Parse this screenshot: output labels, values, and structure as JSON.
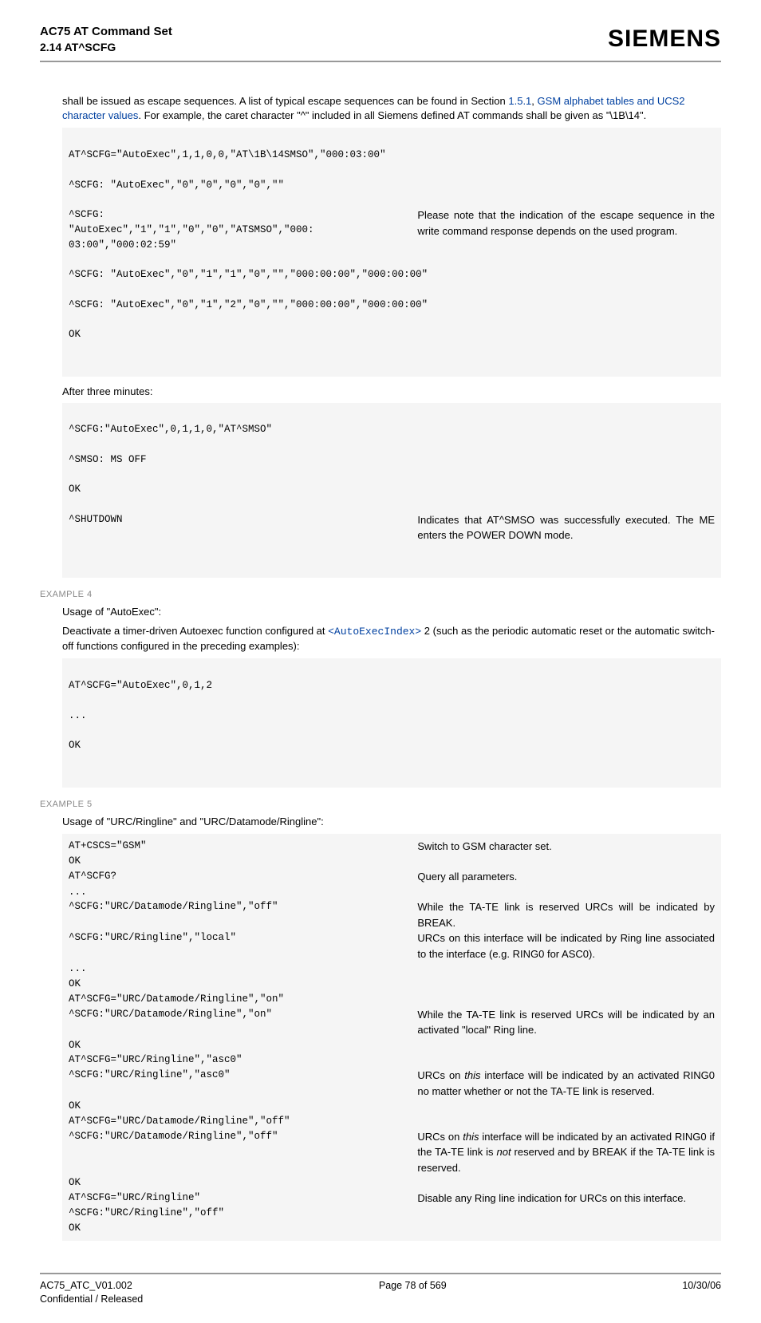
{
  "header": {
    "title_line1": "AC75 AT Command Set",
    "title_line2": "2.14 AT^SCFG",
    "brand": "SIEMENS"
  },
  "intro": {
    "text_before_link": "shall be issued as escape sequences. A list of typical escape sequences can be found in Section ",
    "link1": "1.5.1",
    "sep": ", ",
    "link2": "GSM alphabet tables and UCS2 character values",
    "text_after_link": ". For example, the caret character \"^\" included in all Siemens defined AT commands shall be given as \"\\1B\\14\"."
  },
  "block1": {
    "l1": "AT^SCFG=\"AutoExec\",1,1,0,0,\"AT\\1B\\14SMSO\",\"000:03:00\"",
    "l2": "^SCFG: \"AutoExec\",\"0\",\"0\",\"0\",\"0\",\"\"",
    "row_left": "^SCFG:\n\"AutoExec\",\"1\",\"1\",\"0\",\"0\",\"ATSMSO\",\"000:\n03:00\",\"000:02:59\"",
    "row_right": "Please note that the indication of the escape sequence in the write command response depends on the used program.",
    "l3": "^SCFG: \"AutoExec\",\"0\",\"1\",\"1\",\"0\",\"\",\"000:00:00\",\"000:00:00\"",
    "l4": "^SCFG: \"AutoExec\",\"0\",\"1\",\"2\",\"0\",\"\",\"000:00:00\",\"000:00:00\"",
    "l5": "OK"
  },
  "after_three": "After three minutes:",
  "block2": {
    "l1": "^SCFG:\"AutoExec\",0,1,1,0,\"AT^SMSO\"",
    "l2": "^SMSO: MS OFF",
    "l3": "OK",
    "row_left": "^SHUTDOWN",
    "row_right": "Indicates that AT^SMSO was successfully executed. The ME enters the POWER DOWN mode."
  },
  "example4": {
    "label": "EXAMPLE 4",
    "usage": "Usage of \"AutoExec\":",
    "desc_pre": "Deactivate a timer-driven Autoexec function configured at ",
    "desc_link": "<AutoExecIndex>",
    "desc_post": " 2 (such as the periodic automatic reset or the automatic switch-off functions configured in the preceding examples):",
    "code1": "AT^SCFG=\"AutoExec\",0,1,2",
    "code2": "...",
    "code3": "OK"
  },
  "example5": {
    "label": "EXAMPLE 5",
    "usage": "Usage of \"URC/Ringline\" and \"URC/Datamode/Ringline\":",
    "rows": [
      {
        "left": "AT+CSCS=\"GSM\"",
        "right": "Switch to GSM character set."
      },
      {
        "left": "OK",
        "right": ""
      },
      {
        "left": "AT^SCFG?",
        "right": "Query all parameters."
      },
      {
        "left": "...",
        "right": ""
      },
      {
        "left": "^SCFG:\"URC/Datamode/Ringline\",\"off\"",
        "right": "While the TA-TE link is reserved URCs will be indicated by BREAK."
      },
      {
        "left": "^SCFG:\"URC/Ringline\",\"local\"",
        "right": "URCs on this interface will be indicated by Ring line associated to the interface (e.g. RING0 for ASC0)."
      },
      {
        "left": "...",
        "right": ""
      },
      {
        "left": "OK",
        "right": ""
      },
      {
        "left": "AT^SCFG=\"URC/Datamode/Ringline\",\"on\"",
        "right": ""
      },
      {
        "left": "^SCFG:\"URC/Datamode/Ringline\",\"on\"",
        "right": "While the TA-TE link is reserved URCs will be indicated by an activated \"local\" Ring line."
      },
      {
        "left": "OK",
        "right": ""
      },
      {
        "left": "AT^SCFG=\"URC/Ringline\",\"asc0\"",
        "right": ""
      },
      {
        "left": "^SCFG:\"URC/Ringline\",\"asc0\"",
        "right_html": "URCs on <span class=\"italic\">this</span> interface will be indicated by an activated RING0 no matter whether or not the TA-TE link is reserved."
      },
      {
        "left": "OK",
        "right": ""
      },
      {
        "left": "AT^SCFG=\"URC/Datamode/Ringline\",\"off\"",
        "right": ""
      },
      {
        "left": "^SCFG:\"URC/Datamode/Ringline\",\"off\"",
        "right_html": "URCs on <span class=\"italic\">this</span> interface will be indicated by an activated RING0 if the TA-TE link is <span class=\"italic\">not</span> reserved and by BREAK if the TA-TE link is reserved."
      },
      {
        "left": "OK",
        "right": ""
      },
      {
        "left": "AT^SCFG=\"URC/Ringline\"",
        "right": "Disable any Ring line indication for URCs on this interface."
      },
      {
        "left": "^SCFG:\"URC/Ringline\",\"off\"",
        "right": ""
      },
      {
        "left": "OK",
        "right": ""
      }
    ]
  },
  "footer": {
    "left1": "AC75_ATC_V01.002",
    "left2": "Confidential / Released",
    "center": "Page 78 of 569",
    "right": "10/30/06"
  }
}
